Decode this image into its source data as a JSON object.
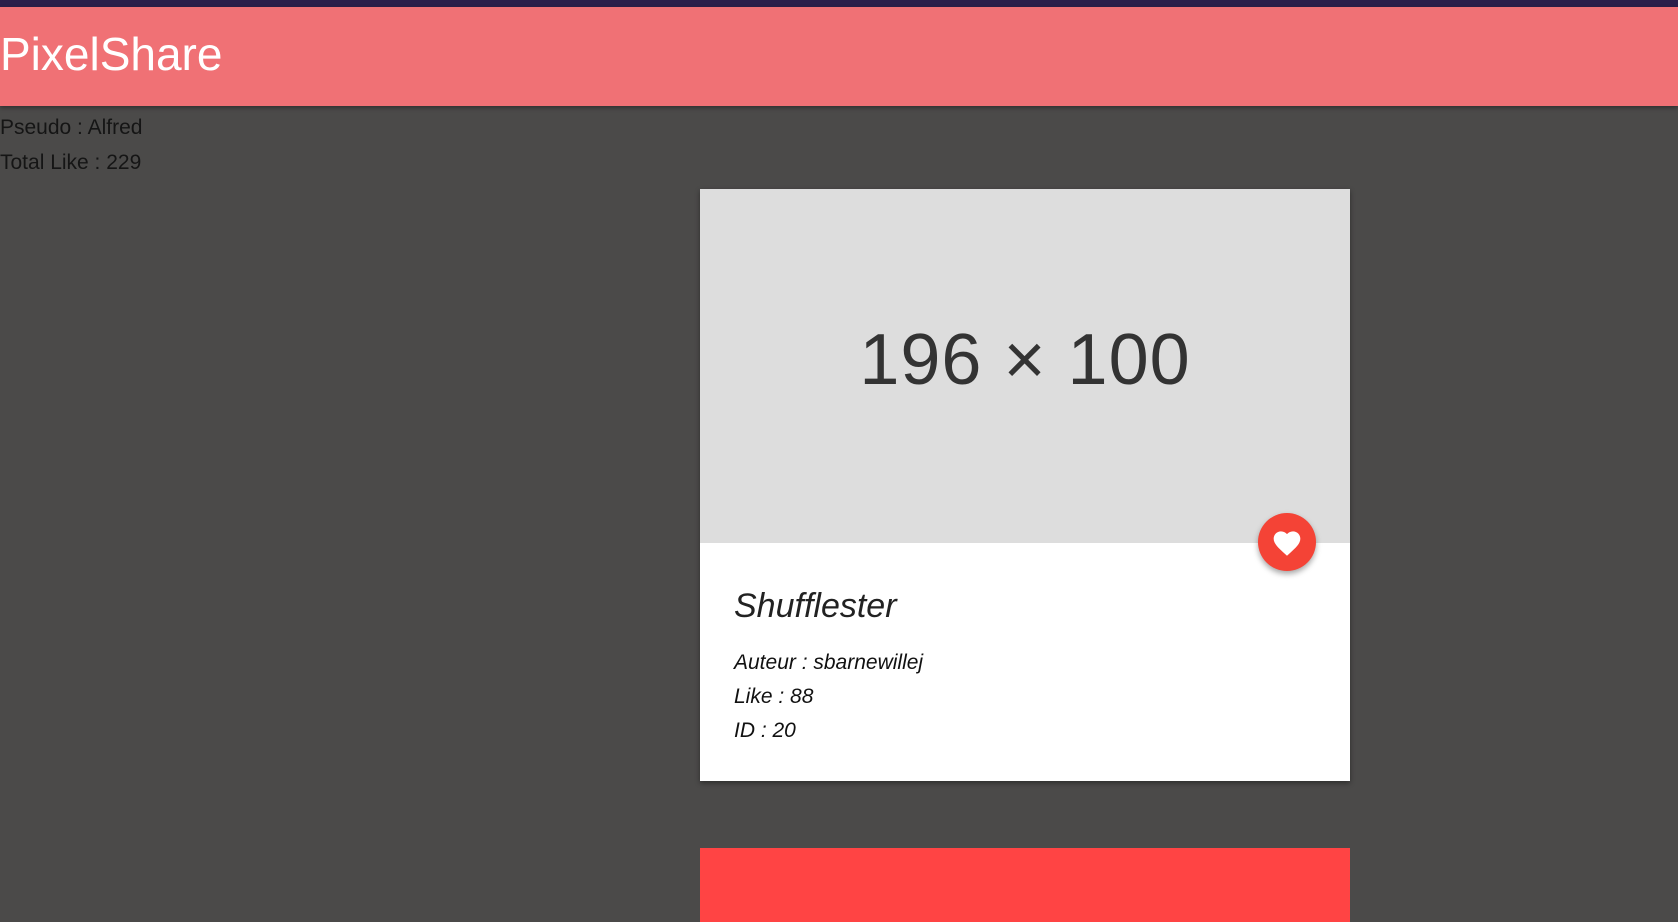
{
  "header": {
    "app_title": "PixelShare"
  },
  "user": {
    "pseudo": "Pseudo : Alfred",
    "total_like": "Total Like : 229"
  },
  "cards": [
    {
      "image_placeholder": "196 × 100",
      "title": "Shufflester",
      "author": "Auteur : sbarnewillej",
      "likes": "Like : 88",
      "id": "ID : 20",
      "like_icon": "heart-icon"
    }
  ],
  "colors": {
    "header_bg": "#f07175",
    "topbar_bg": "#2c1f4a",
    "page_bg": "#4b4a49",
    "fab_bg": "#f44336",
    "second_card_bg": "#ff4444"
  }
}
